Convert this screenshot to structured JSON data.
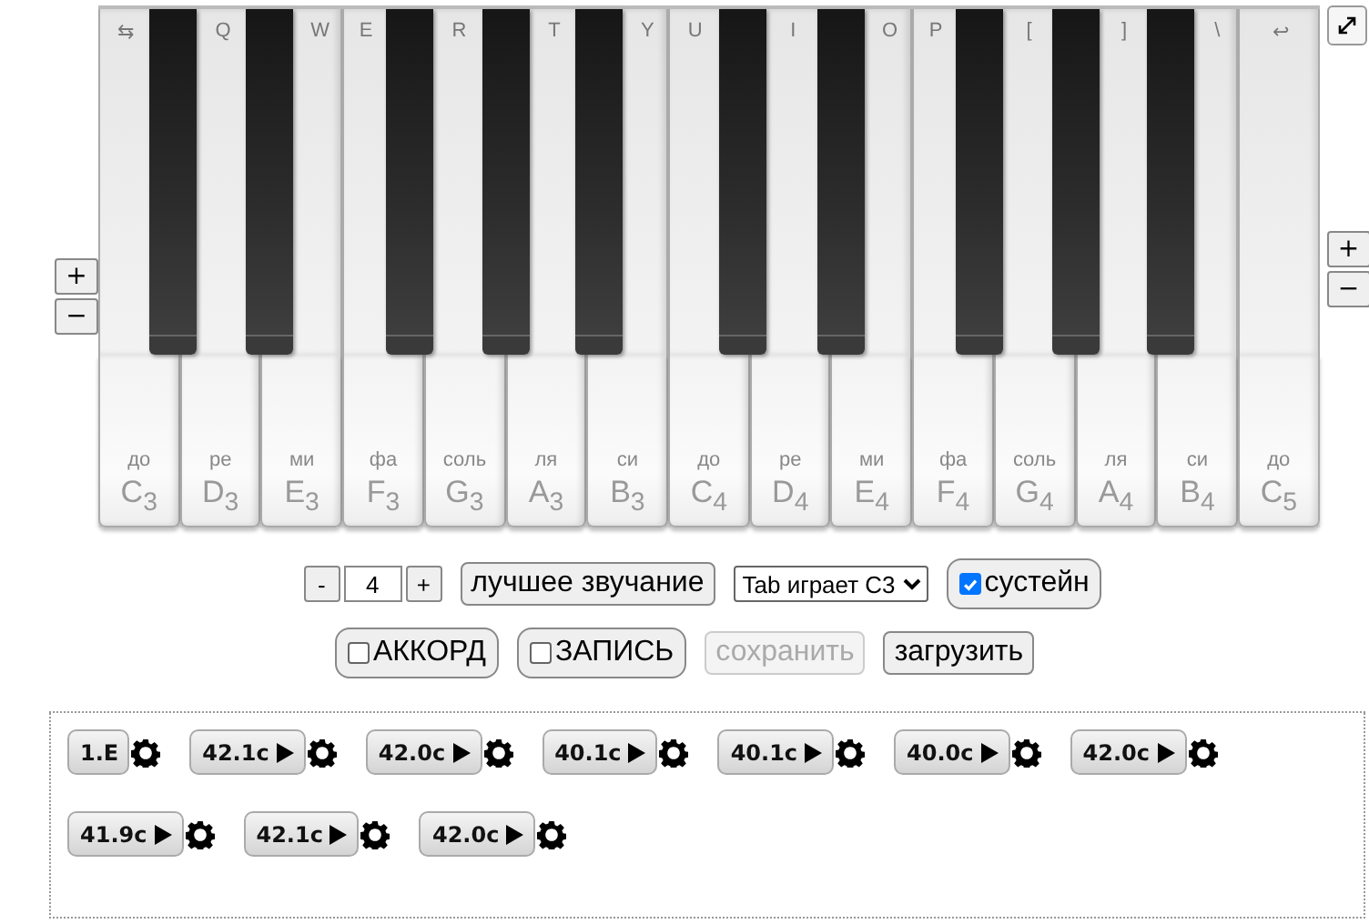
{
  "piano": {
    "white_keys": [
      {
        "key": "⇆",
        "solfege": "до",
        "note": "C$_{3}$"
      },
      {
        "key": "Q",
        "solfege": "ре",
        "note": "D$_{3}$"
      },
      {
        "key": "W",
        "solfege": "ми",
        "note": "E$_{3}$"
      },
      {
        "key": "E",
        "solfege": "фа",
        "note": "F$_{3}$"
      },
      {
        "key": "R",
        "solfege": "соль",
        "note": "G$_{3}$"
      },
      {
        "key": "T",
        "solfege": "ля",
        "note": "A$_{3}$"
      },
      {
        "key": "Y",
        "solfege": "си",
        "note": "B$_{3}$"
      },
      {
        "key": "U",
        "solfege": "до",
        "note": "C$_{4}$"
      },
      {
        "key": "I",
        "solfege": "ре",
        "note": "D$_{4}$"
      },
      {
        "key": "O",
        "solfege": "ми",
        "note": "E$_{4}$"
      },
      {
        "key": "P",
        "solfege": "фа",
        "note": "F$_{4}$"
      },
      {
        "key": "[",
        "solfege": "соль",
        "note": "G$_{4}$"
      },
      {
        "key": "]",
        "solfege": "ля",
        "note": "A$_{4}$"
      },
      {
        "key": "\\",
        "solfege": "си",
        "note": "B$_{4}$"
      },
      {
        "key": "↩",
        "solfege": "до",
        "note": "C$_{5}$"
      }
    ],
    "left_zoom": [
      "+",
      "−"
    ],
    "right_zoom": [
      "+",
      "−"
    ]
  },
  "controls": {
    "octave": {
      "minus": "-",
      "value": "4",
      "plus": "+"
    },
    "quality_button": "лучшее звучание",
    "tab_select": "Tab играет C3",
    "sustain": {
      "label": "сустейн",
      "checked": true
    },
    "chord": {
      "label": "АККОРД",
      "checked": false
    },
    "record": {
      "label": "ЗАПИСЬ",
      "checked": false
    },
    "save": {
      "label": "сохранить",
      "disabled": true
    },
    "load": {
      "label": "загрузить",
      "disabled": false
    }
  },
  "recordings": [
    {
      "label": "1.E",
      "kind": "note"
    },
    {
      "label": "42.1c",
      "kind": "take"
    },
    {
      "label": "42.0c",
      "kind": "take"
    },
    {
      "label": "40.1c",
      "kind": "take"
    },
    {
      "label": "40.1c",
      "kind": "take"
    },
    {
      "label": "40.0c",
      "kind": "take"
    },
    {
      "label": "42.0c",
      "kind": "take"
    },
    {
      "label": "41.9c",
      "kind": "take"
    },
    {
      "label": "42.1c",
      "kind": "take"
    },
    {
      "label": "42.0c",
      "kind": "take"
    }
  ]
}
